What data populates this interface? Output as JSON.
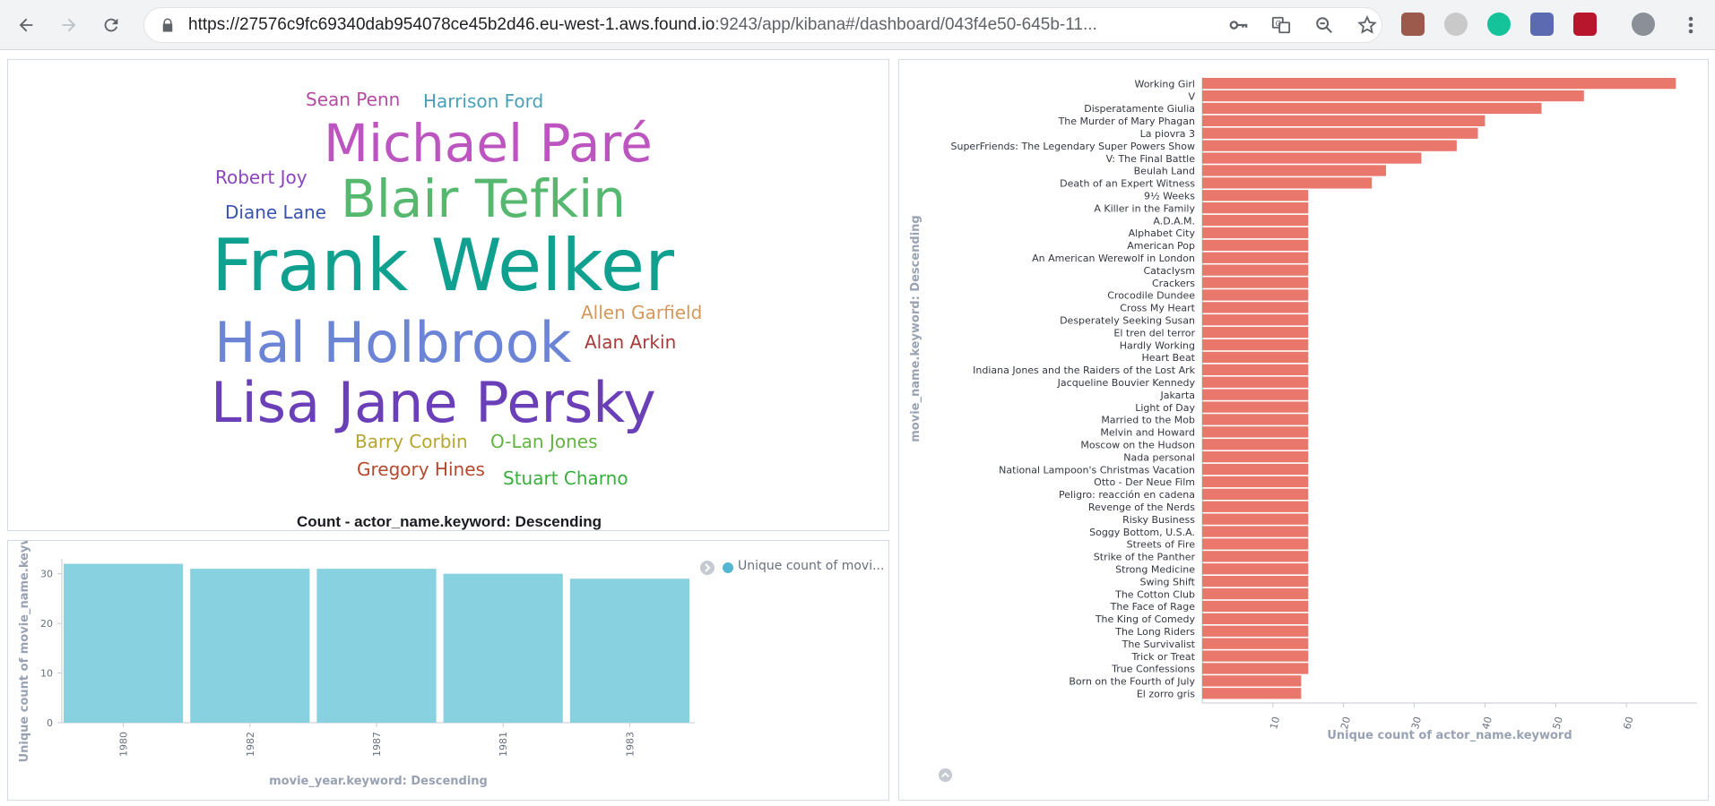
{
  "browser": {
    "url_host": "https://27576c9fc69340dab954078ce45b2d46.eu-west-1.aws.found.io",
    "url_rest": ":9243/app/kibana#/dashboard/043f4e50-645b-11...",
    "colors": {
      "toolbar": "#f1f3f4"
    }
  },
  "wordcloud": {
    "caption": "Count - actor_name.keyword: Descending",
    "words": [
      {
        "text": "Sean Penn",
        "color": "#b44ba4",
        "size": 20
      },
      {
        "text": "Harrison Ford",
        "color": "#47a0b6",
        "size": 20
      },
      {
        "text": "Michael Paré",
        "color": "#bd55c0",
        "size": 58
      },
      {
        "text": "Robert Joy",
        "color": "#8d45bf",
        "size": 20
      },
      {
        "text": "Blair Tefkin",
        "color": "#55b86e",
        "size": 58
      },
      {
        "text": "Diane Lane",
        "color": "#3a52b0",
        "size": 20
      },
      {
        "text": "Frank Welker",
        "color": "#10a08f",
        "size": 80
      },
      {
        "text": "Allen Garfield",
        "color": "#d6985a",
        "size": 20
      },
      {
        "text": "Hal Holbrook",
        "color": "#6c84d6",
        "size": 62
      },
      {
        "text": "Alan Arkin",
        "color": "#a83a3a",
        "size": 20
      },
      {
        "text": "Lisa Jane Persky",
        "color": "#6a3fb8",
        "size": 62
      },
      {
        "text": "Barry Corbin",
        "color": "#b7a532",
        "size": 20
      },
      {
        "text": "O-Lan Jones",
        "color": "#61b43f",
        "size": 20
      },
      {
        "text": "Gregory Hines",
        "color": "#b4492d",
        "size": 20
      },
      {
        "text": "Stuart Charno",
        "color": "#3aae3d",
        "size": 20
      }
    ]
  },
  "year_chart": {
    "legend_label": "Unique count of movi...",
    "legend_color": "#54b6d0"
  },
  "chart_data": [
    {
      "type": "bar",
      "xlabel": "movie_year.keyword: Descending",
      "ylabel": "Unique count of movie_name.keyw",
      "categories": [
        "1980",
        "1982",
        "1987",
        "1981",
        "1983"
      ],
      "values": [
        32,
        31,
        31,
        30,
        29
      ],
      "ylim": [
        0,
        33
      ],
      "yticks": [
        0,
        10,
        20,
        30
      ],
      "color": "#87d1e0",
      "legend": "top-right"
    },
    {
      "type": "bar",
      "orientation": "horizontal",
      "xlabel": "Unique count of actor_name.keyword",
      "ylabel": "movie_name.keyword: Descending",
      "color": "#ea776b",
      "xlim": [
        0,
        70
      ],
      "xticks": [
        10,
        20,
        30,
        40,
        50,
        60
      ],
      "categories": [
        "Working Girl",
        "V",
        "Disperatamente Giulia",
        "The Murder of Mary Phagan",
        "La piovra 3",
        "SuperFriends: The Legendary Super Powers Show",
        "V: The Final Battle",
        "Beulah Land",
        "Death of an Expert Witness",
        "9½ Weeks",
        "A Killer in the Family",
        "A.D.A.M.",
        "Alphabet City",
        "American Pop",
        "An American Werewolf in London",
        "Cataclysm",
        "Crackers",
        "Crocodile Dundee",
        "Cross My Heart",
        "Desperately Seeking Susan",
        "El tren del terror",
        "Hardly Working",
        "Heart Beat",
        "Indiana Jones and the Raiders of the Lost Ark",
        "Jacqueline Bouvier Kennedy",
        "Jakarta",
        "Light of Day",
        "Married to the Mob",
        "Melvin and Howard",
        "Moscow on the Hudson",
        "Nada personal",
        "National Lampoon's Christmas Vacation",
        "Otto - Der Neue Film",
        "Peligro: reacción en cadena",
        "Revenge of the Nerds",
        "Risky Business",
        "Soggy Bottom, U.S.A.",
        "Streets of Fire",
        "Strike of the Panther",
        "Strong Medicine",
        "Swing Shift",
        "The Cotton Club",
        "The Face of Rage",
        "The King of Comedy",
        "The Long Riders",
        "The Survivalist",
        "Trick or Treat",
        "True Confessions",
        "Born on the Fourth of July",
        "El zorro gris"
      ],
      "values": [
        67,
        54,
        48,
        40,
        39,
        36,
        31,
        26,
        24,
        15,
        15,
        15,
        15,
        15,
        15,
        15,
        15,
        15,
        15,
        15,
        15,
        15,
        15,
        15,
        15,
        15,
        15,
        15,
        15,
        15,
        15,
        15,
        15,
        15,
        15,
        15,
        15,
        15,
        15,
        15,
        15,
        15,
        15,
        15,
        15,
        15,
        15,
        15,
        14,
        14
      ]
    }
  ]
}
